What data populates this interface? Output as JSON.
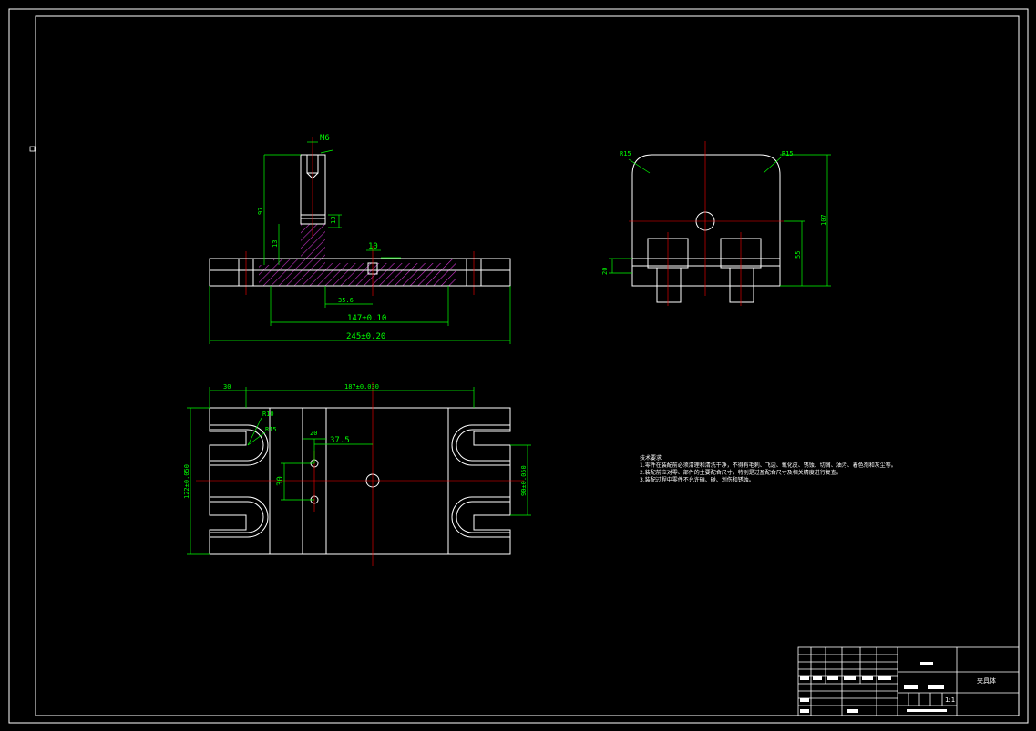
{
  "drawing": {
    "colors": {
      "background": "#000000",
      "outline": "#ffffff",
      "dimension": "#00ff00",
      "centerline": "#ff0000",
      "hatch": "#cc33cc"
    },
    "front_view": {
      "dims": {
        "width_overall": "245±0.20",
        "width_mid": "147±0.10",
        "slot": "10",
        "thread": "M6",
        "height": "97",
        "step": "13",
        "small": "13",
        "bottom": "35.6"
      }
    },
    "side_view": {
      "dims": {
        "r_left": "R15",
        "r_right": "R15",
        "height": "107",
        "mid": "55",
        "left_small": "20"
      }
    },
    "top_view": {
      "dims": {
        "top_width": "187±0.030",
        "left_30": "30",
        "r10": "R10",
        "r15": "R15",
        "d20": "20",
        "d375": "37.5",
        "vert_30": "30",
        "left_height": "122±0.050",
        "right_height": "90±0.050"
      }
    },
    "technical_notes": {
      "title": "技术要求",
      "items": [
        "1.零件在装配前必须清理和清洗干净，不得有毛刺、飞边、氧化皮、锈蚀、切屑、油污、着色剂和灰尘等。",
        "2.装配前应对零、部件的主要配合尺寸，特别是过盈配合尺寸及相关精度进行复查。",
        "3.装配过程中零件不允许磕、碰、划伤和锈蚀。"
      ]
    },
    "title_block": {
      "part_name": "夹具体",
      "scale": "1:1"
    }
  }
}
